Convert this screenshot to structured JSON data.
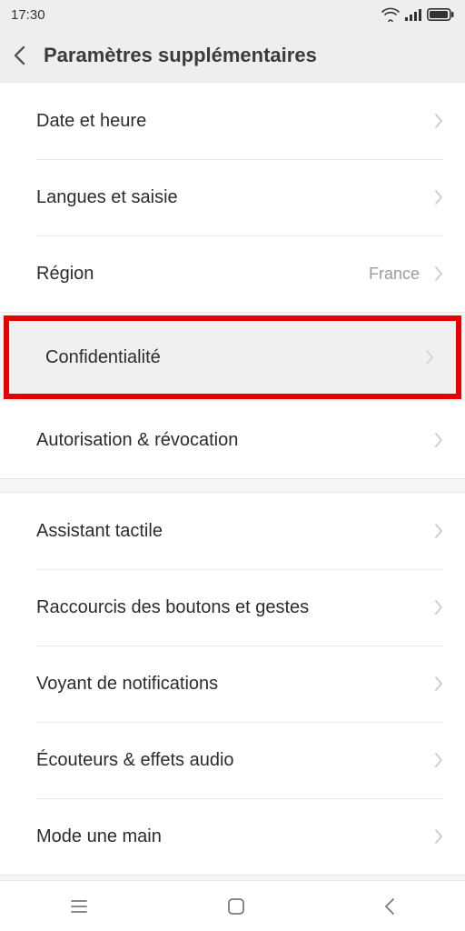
{
  "statusBar": {
    "time": "17:30"
  },
  "header": {
    "title": "Paramètres supplémentaires"
  },
  "group1": {
    "date_time": {
      "label": "Date et heure"
    },
    "languages": {
      "label": "Langues et saisie"
    },
    "region": {
      "label": "Région",
      "value": "France"
    }
  },
  "group2": {
    "privacy": {
      "label": "Confidentialité"
    },
    "auth": {
      "label": "Autorisation & révocation"
    }
  },
  "group3": {
    "assistant": {
      "label": "Assistant tactile"
    },
    "shortcuts": {
      "label": "Raccourcis des boutons et gestes"
    },
    "led": {
      "label": "Voyant de notifications"
    },
    "audio": {
      "label": "Écouteurs & effets audio"
    },
    "onehand": {
      "label": "Mode une main"
    }
  }
}
